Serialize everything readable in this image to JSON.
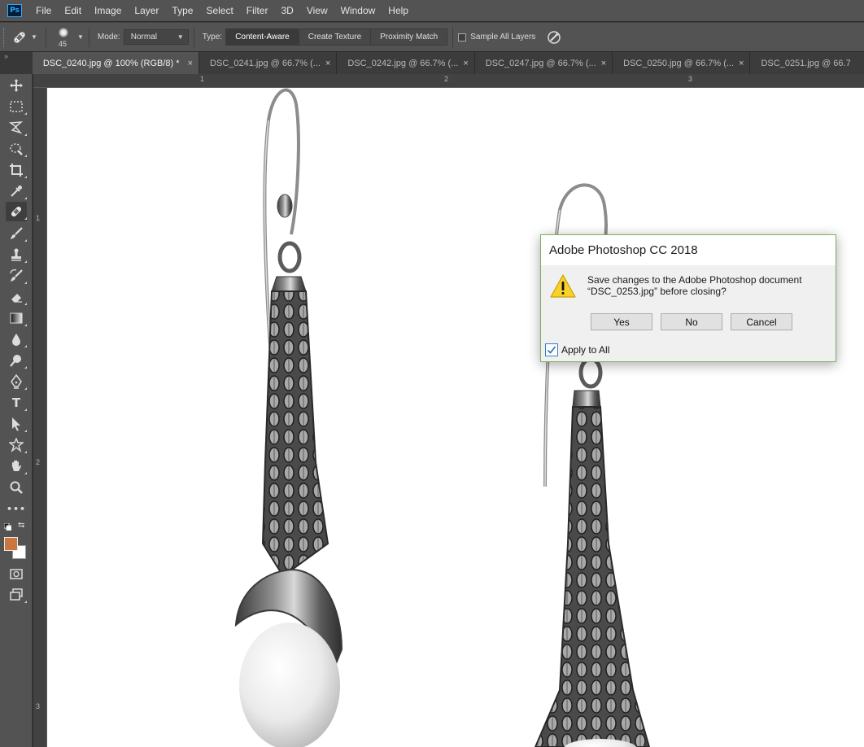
{
  "app": {
    "logo_text": "Ps"
  },
  "menu": [
    "File",
    "Edit",
    "Image",
    "Layer",
    "Type",
    "Select",
    "Filter",
    "3D",
    "View",
    "Window",
    "Help"
  ],
  "options": {
    "tool_icon": "spot-healing-brush-icon",
    "brush_size": "45",
    "mode_label": "Mode:",
    "mode_value": "Normal",
    "type_label": "Type:",
    "type_buttons": [
      "Content-Aware",
      "Create Texture",
      "Proximity Match"
    ],
    "sample_all_layers": "Sample All Layers",
    "sample_all_layers_checked": false
  },
  "tab_gutter": "»",
  "tabs": [
    {
      "label": "DSC_0240.jpg @ 100% (RGB/8) *",
      "active": true
    },
    {
      "label": "DSC_0241.jpg @ 66.7% (...",
      "active": false
    },
    {
      "label": "DSC_0242.jpg @ 66.7% (...",
      "active": false
    },
    {
      "label": "DSC_0247.jpg @ 66.7% (...",
      "active": false
    },
    {
      "label": "DSC_0250.jpg @ 66.7% (...",
      "active": false
    },
    {
      "label": "DSC_0251.jpg @ 66.7",
      "active": false
    }
  ],
  "tab_close": "×",
  "rulers": {
    "top_numbers": [
      "1",
      "2",
      "3"
    ],
    "left_numbers": [
      "1",
      "2",
      "3"
    ]
  },
  "toolbar": {
    "tools": [
      "move-icon",
      "marquee-icon",
      "lasso-icon",
      "quick-select-icon",
      "crop-icon",
      "eyedropper-icon",
      "spot-healing-brush-icon",
      "brush-icon",
      "clone-stamp-icon",
      "history-brush-icon",
      "eraser-icon",
      "gradient-icon",
      "blur-icon",
      "dodge-icon",
      "pen-icon",
      "type-icon",
      "path-select-icon",
      "shape-icon",
      "hand-icon",
      "zoom-icon",
      "more-tools-icon"
    ],
    "type_glyph": "T",
    "more_glyph": "•••",
    "swap_glyph": "⇆",
    "foreground_color": "#c9773a",
    "background_color": "#ffffff"
  },
  "dialog": {
    "title": "Adobe Photoshop CC 2018",
    "message_line1": "Save changes to the Adobe Photoshop document",
    "message_line2": "“DSC_0253.jpg” before closing?",
    "buttons": [
      "Yes",
      "No",
      "Cancel"
    ],
    "apply_to_all": "Apply to All",
    "apply_to_all_checked": true
  }
}
